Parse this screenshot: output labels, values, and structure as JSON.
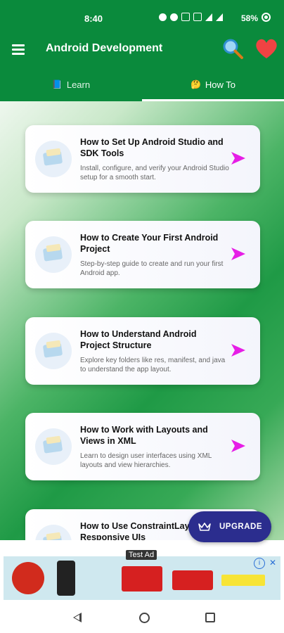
{
  "status_bar": {
    "time": "8:40",
    "battery": "58%"
  },
  "app_bar": {
    "title": "Android Development",
    "menu_icon": "hamburger-menu-icon",
    "search_icon": "search-icon",
    "heart_icon": "heart-icon"
  },
  "tabs": [
    {
      "label": "Learn",
      "icon": "book-icon",
      "glyph": "📘",
      "active": false
    },
    {
      "label": "How To",
      "icon": "thinking-face-icon",
      "glyph": "🤔",
      "active": true
    }
  ],
  "cards": [
    {
      "title": "How to Set Up Android Studio and SDK Tools",
      "description": "Install, configure, and verify your Android Studio setup for a smooth start."
    },
    {
      "title": "How to Create Your First Android Project",
      "description": "Step-by-step guide to create and run your first Android app."
    },
    {
      "title": "How to Understand Android Project Structure",
      "description": "Explore key folders like res, manifest, and java to understand the app layout."
    },
    {
      "title": "How to Work with Layouts and Views in XML",
      "description": "Learn to design user interfaces using XML layouts and view hierarchies."
    },
    {
      "title": "How to Use ConstraintLayout for Responsive UIs",
      "description": ""
    }
  ],
  "upgrade_button": {
    "label": "UPGRADE",
    "icon": "crown-icon"
  },
  "ad": {
    "label": "Test Ad"
  },
  "colors": {
    "primary": "#0a8a3c",
    "arrow": "#e61ee6",
    "upgrade": "#2b2d8e"
  }
}
